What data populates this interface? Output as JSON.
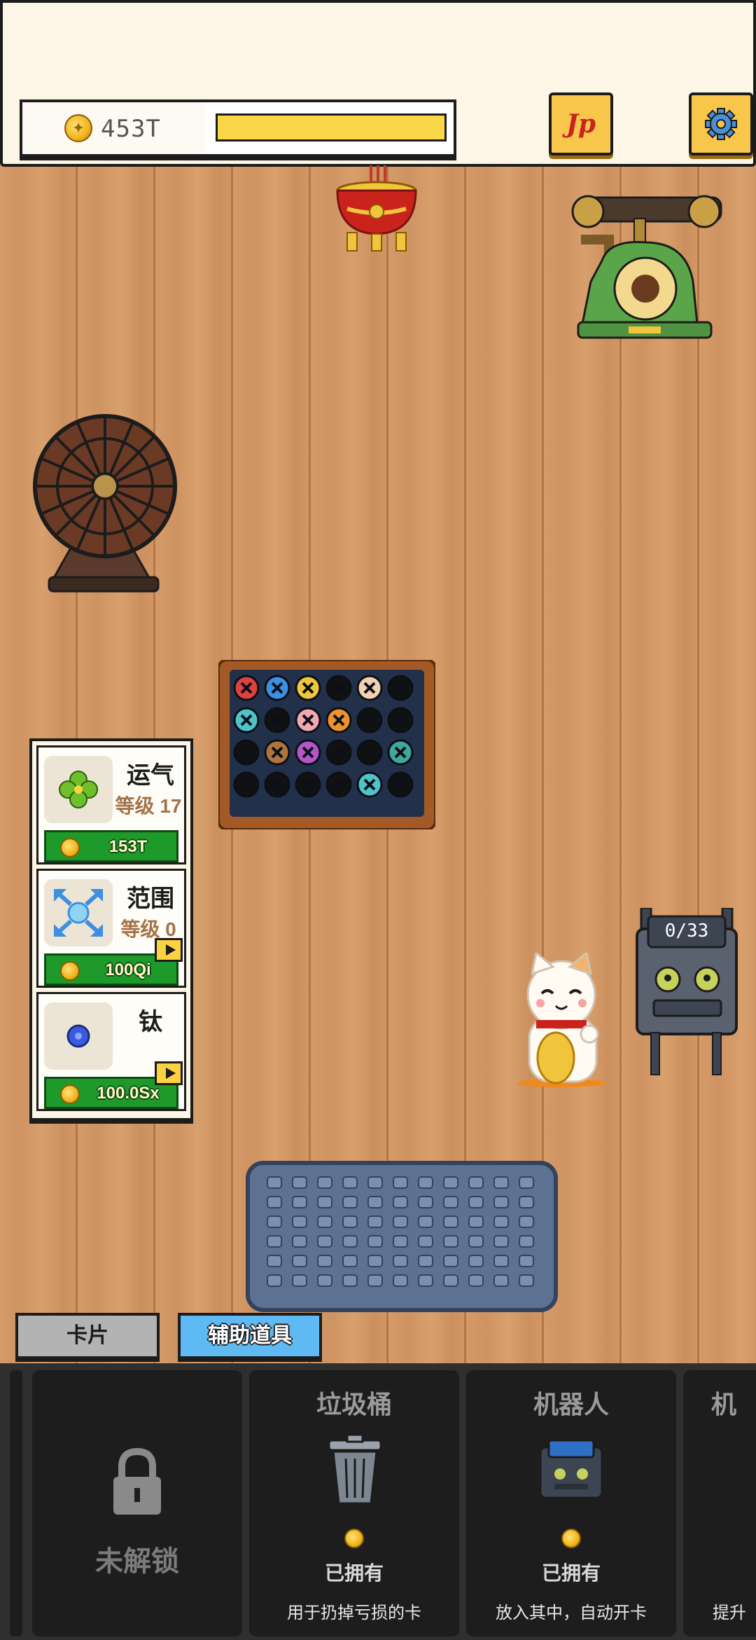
{
  "header": {
    "currency_value": "453T",
    "progress_fraction": 1.0,
    "jp_label": "Jp"
  },
  "upgrades": [
    {
      "title": "运气",
      "level": "等级 17",
      "cost": "153T",
      "icon": "clover-icon",
      "video": false
    },
    {
      "title": "范围",
      "level": "等级 0",
      "cost": "100Qi",
      "icon": "expand-arrows-icon",
      "video": true
    },
    {
      "title": "钛",
      "level": "",
      "cost": "100.0Sx",
      "icon": "blue-orb-icon",
      "video": true
    }
  ],
  "robot_counter": "0/33",
  "tabs": {
    "cards": "卡片",
    "tools": "辅助道具"
  },
  "tray": {
    "locked_label": "未解锁",
    "cards": [
      {
        "title": "垃圾桶",
        "status": "已拥有",
        "desc": "用于扔掉亏损的卡",
        "icon": "trash-can-icon"
      },
      {
        "title": "机器人",
        "status": "已拥有",
        "desc": "放入其中，自动开卡",
        "icon": "robot-icon"
      },
      {
        "title": "机",
        "status": "",
        "desc": "提升",
        "icon": ""
      }
    ]
  },
  "colors": {
    "accent_yellow": "#f8c64a",
    "cost_green": "#1e9a2b",
    "tab_active": "#5fb9f3",
    "table_wood": "#d49a68"
  }
}
